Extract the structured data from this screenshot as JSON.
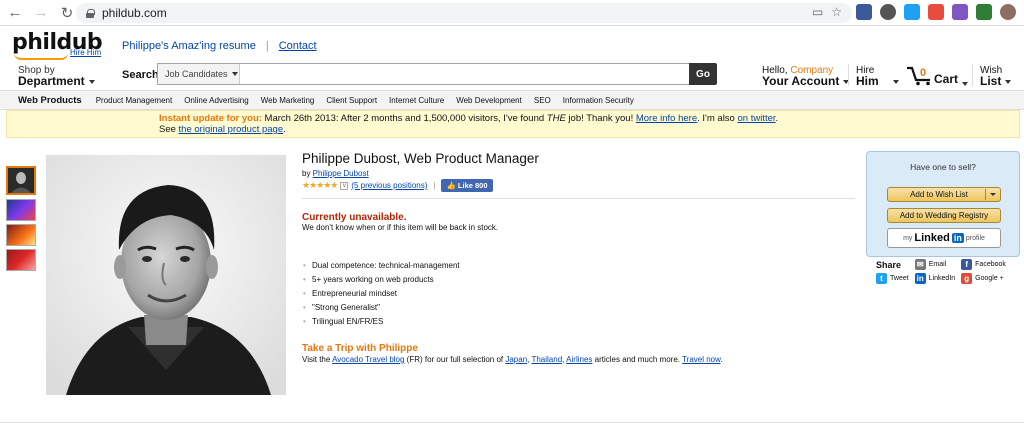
{
  "browser": {
    "url": "phildub.com"
  },
  "header": {
    "logo_text": "phildub",
    "logo_tag": "Hire Him",
    "top_links": [
      "Philippe's Amaz'ing resume",
      "Contact"
    ],
    "shop_by_line1": "Shop by",
    "shop_by_line2": "Department",
    "search_label": "Search",
    "search_category": "Job Candidates",
    "search_value": "",
    "go_label": "Go",
    "hello_prefix": "Hello, ",
    "hello_name": "Company",
    "your_account": "Your Account",
    "hire_line1": "Hire",
    "hire_line2": "Him",
    "cart_count": "0",
    "cart_label": "Cart",
    "wish_line1": "Wish",
    "wish_line2": "List"
  },
  "categories": [
    "Web Products",
    "Product Management",
    "Online Advertising",
    "Web Marketing",
    "Client Support",
    "Internet Culture",
    "Web Development",
    "SEO",
    "Information Security"
  ],
  "notice": {
    "highlight": "Instant update for you:",
    "text_a": " March 26th 2013: After 2 months and 1,500,000 visitors, I've found ",
    "text_em": "THE",
    "text_b": " job! Thank you! ",
    "link1": "More info here",
    "text_c": ". I'm also ",
    "link2": "on twitter",
    "text_d": ".",
    "line2_prefix": "See ",
    "link3": "the original product page",
    "line2_suffix": "."
  },
  "product": {
    "title": "Philippe Dubost, Web Product Manager",
    "by_prefix": "by ",
    "by_name": "Philippe Dubost",
    "stars": "★★★★★",
    "reviews_link": "(5 previous positions)",
    "like_label": "Like 800",
    "unavailable": "Currently unavailable.",
    "unavailable_sub": "We don't know when or if this item will be back in stock.",
    "bullets": [
      "Dual competence: technical-management",
      "5+ years working on web products",
      "Entrepreneurial mindset",
      "\"Strong Generalist\"",
      "Trilingual EN/FR/ES"
    ],
    "trip_title": "Take a Trip with Philippe",
    "trip_a": "Visit the ",
    "trip_link1": "Avocado Travel blog",
    "trip_b": " (FR) for our full selection of ",
    "trip_link2": "Japan",
    "trip_c": ", ",
    "trip_link3": "Thailand",
    "trip_d": ", ",
    "trip_link4": "Airlines",
    "trip_e": " articles and much more. ",
    "trip_link5": "Travel now",
    "trip_f": "."
  },
  "sellbox": {
    "header": "Have one to sell?",
    "wish_btn": "Add to Wish List",
    "wedding_btn": "Add to Wedding Registry",
    "linkedin_my": "my",
    "linkedin_word": "Linked",
    "linkedin_in": "in",
    "linkedin_profile": "profile"
  },
  "share": {
    "label": "Share",
    "email": "Email",
    "facebook": "Facebook",
    "tweet": "Tweet",
    "linkedin": "LinkedIn",
    "google": "Google +"
  },
  "colors": {
    "accent": "#e47911",
    "link": "#0645ad",
    "alert": "#b12704"
  }
}
